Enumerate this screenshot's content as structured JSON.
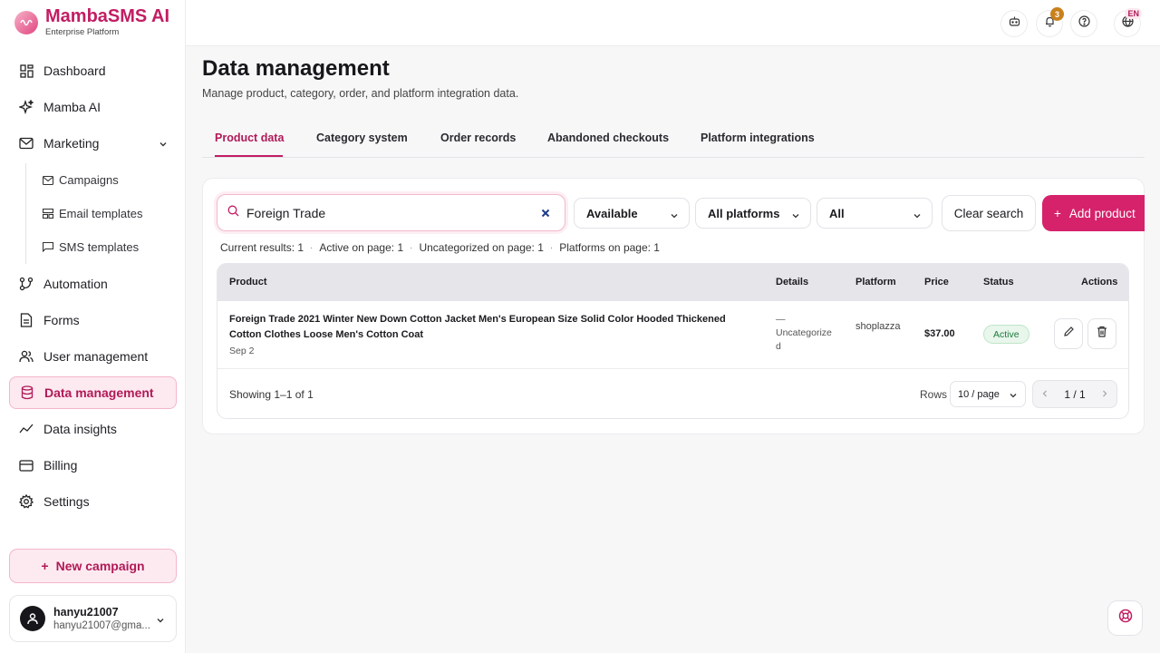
{
  "brand": {
    "name": "MambaSMS AI",
    "subtitle": "Enterprise Platform",
    "color": "#c21d63"
  },
  "sidebar": {
    "items": [
      {
        "label": "Dashboard",
        "icon": "dashboard-icon"
      },
      {
        "label": "Mamba AI",
        "icon": "sparkles-icon"
      },
      {
        "label": "Marketing",
        "icon": "mail-icon",
        "expanded": true
      },
      {
        "label": "Automation",
        "icon": "flow-icon"
      },
      {
        "label": "Forms",
        "icon": "document-icon"
      },
      {
        "label": "User management",
        "icon": "users-icon"
      },
      {
        "label": "Data management",
        "icon": "database-icon",
        "active": true
      },
      {
        "label": "Data insights",
        "icon": "chart-icon"
      },
      {
        "label": "Billing",
        "icon": "card-icon"
      },
      {
        "label": "Settings",
        "icon": "gear-icon"
      }
    ],
    "marketing_sub": [
      {
        "label": "Campaigns",
        "icon": "mail-icon"
      },
      {
        "label": "Email templates",
        "icon": "template-icon"
      },
      {
        "label": "SMS templates",
        "icon": "message-icon"
      }
    ],
    "new_campaign": "New campaign",
    "user": {
      "name": "hanyu21007",
      "email": "hanyu21007@gma..."
    }
  },
  "topbar": {
    "notifications_count": "3",
    "language": "EN"
  },
  "page": {
    "title": "Data management",
    "subtitle": "Manage product, category, order, and platform integration data."
  },
  "tabs": [
    "Product data",
    "Category system",
    "Order records",
    "Abandoned checkouts",
    "Platform integrations"
  ],
  "filters": {
    "search_value": "Foreign Trade",
    "availability": "Available",
    "platform": "All platforms",
    "status": "All",
    "clear_label": "Clear search",
    "add_label": "Add product"
  },
  "stats": [
    "Current results: 1",
    "Active on page: 1",
    "Uncategorized on page: 1",
    "Platforms on page: 1"
  ],
  "table": {
    "columns": [
      "Product",
      "Details",
      "Platform",
      "Price",
      "Status",
      "Actions"
    ],
    "rows": [
      {
        "product": "Foreign Trade 2021 Winter New Down Cotton Jacket Men's European Size Solid Color Hooded Thickened Cotton Clothes Loose Men's Cotton Coat",
        "date": "Sep 2",
        "details_dash": "—",
        "details": "Uncategorized",
        "platform": "shoplazza",
        "price": "$37.00",
        "status": "Active"
      }
    ],
    "showing": "Showing 1–1 of 1",
    "rows_label": "Rows",
    "rows_per_page": "10 / page",
    "page": "1 / 1"
  }
}
